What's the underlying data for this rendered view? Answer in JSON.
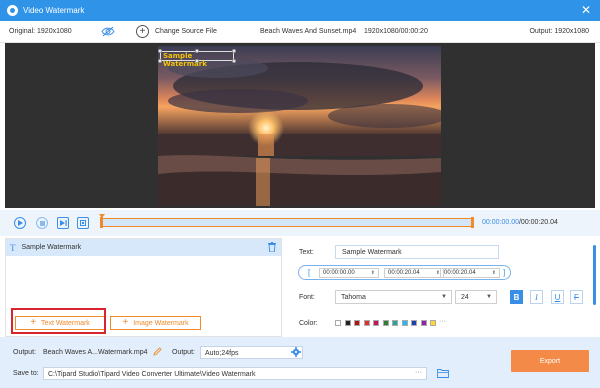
{
  "window": {
    "title": "Video Watermark",
    "close_glyph": "✕",
    "logo_icon": "app-logo-icon"
  },
  "infobar": {
    "original_label": "Original: 1920x1080",
    "change_source_label": "Change Source File",
    "file_name": "Beach Waves And Sunset.mp4",
    "resolution_duration": "1920x1080/00:00:20",
    "output_label": "Output: 1920x1080"
  },
  "watermark_preview": {
    "text": "Sample Watermark",
    "color": "#f2c40a"
  },
  "controls": {
    "current_time": "00:00:00.00",
    "total_time": "/00:00:20.04",
    "accent": "#3a8ee6",
    "trim_color": "#f08a2b"
  },
  "watermark_list": {
    "items": [
      {
        "type_glyph": "T",
        "label": "Sample Watermark"
      }
    ],
    "add_text_label": "Text Watermark",
    "add_image_label": "Image Watermark",
    "plus_glyph": "+"
  },
  "properties": {
    "text_label": "Text:",
    "text_value": "Sample Watermark",
    "bracket_left": "[",
    "bracket_right": "]",
    "start_time": "00:00:00.00",
    "end_time": "00:00:20.04",
    "duration": "00:00:20.04",
    "spinner_glyph": "⬍",
    "font_label": "Font:",
    "font_family": "Tahoma",
    "font_size": "24",
    "dropdown_glyph": "▼",
    "style_buttons": {
      "bold": "B",
      "italic": "I",
      "underline": "U",
      "strike": "F"
    },
    "color_label": "Color:",
    "swatches": [
      "#ffffff",
      "#222222",
      "#b31217",
      "#e0312f",
      "#c2185b",
      "#2e7d32",
      "#26a69a",
      "#29b6f6",
      "#1e3fae",
      "#8e24aa",
      "#fdd835"
    ],
    "more_colors": "···"
  },
  "bottom": {
    "output_label": "Output:",
    "output_file": "Beach Waves A...Watermark.mp4",
    "output_settings_label": "Output:",
    "output_settings_value": "Auto;24fps",
    "save_to_label": "Save to:",
    "save_path": "C:\\Tipard Studio\\Tipard Video Converter Ultimate\\Video Watermark",
    "more_glyph": "···",
    "export_label": "Export",
    "export_color": "#f48a47"
  }
}
